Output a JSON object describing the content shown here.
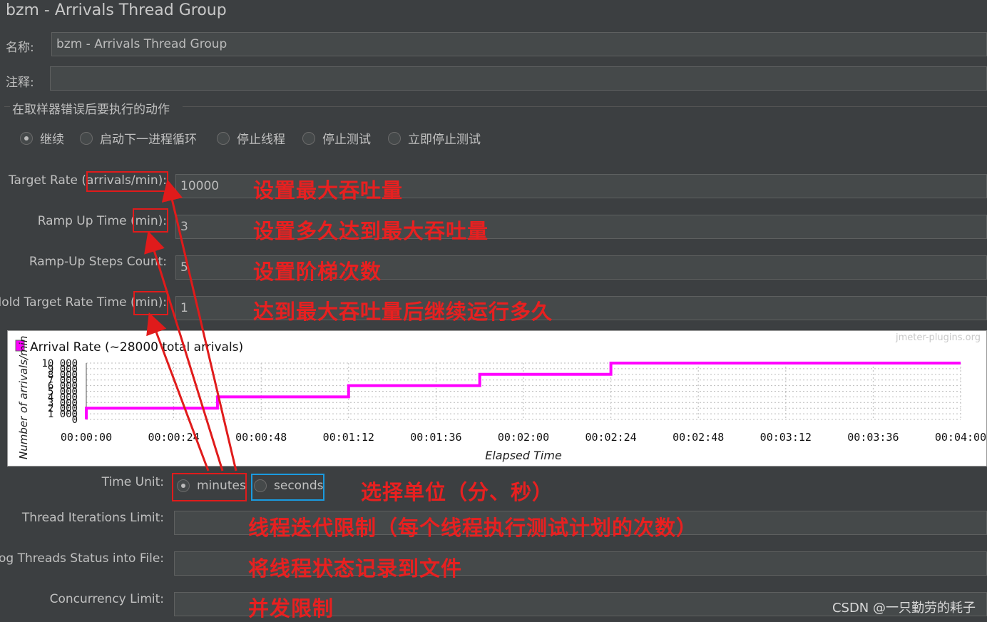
{
  "window": {
    "title": "bzm - Arrivals Thread Group"
  },
  "form": {
    "name_label": "名称:",
    "name_value": "bzm - Arrivals Thread Group",
    "comment_label": "注释:",
    "comment_value": "",
    "error_group_title": "在取样器错误后要执行的动作",
    "error_actions": [
      {
        "label": "继续",
        "selected": true
      },
      {
        "label": "启动下一进程循环",
        "selected": false
      },
      {
        "label": "停止线程",
        "selected": false
      },
      {
        "label": "停止测试",
        "selected": false
      },
      {
        "label": "立即停止测试",
        "selected": false
      }
    ],
    "target_rate_label": "Target Rate (arrivals/min):",
    "target_rate_value": "10000",
    "ramp_up_label": "Ramp Up Time (min):",
    "ramp_up_value": "3",
    "steps_label": "Ramp-Up Steps Count:",
    "steps_value": "5",
    "hold_label": "Hold Target Rate Time (min):",
    "hold_value": "1",
    "time_unit_label": "Time Unit:",
    "time_unit_options": [
      {
        "label": "minutes",
        "selected": true
      },
      {
        "label": "seconds",
        "selected": false
      }
    ],
    "iterations_label": "Thread Iterations Limit:",
    "iterations_value": "",
    "log_label": "Log Threads Status into File:",
    "log_value": "",
    "concurrency_label": "Concurrency Limit:",
    "concurrency_value": ""
  },
  "annotations": {
    "target_rate": "设置最大吞吐量",
    "ramp_up": "设置多久达到最大吞吐量",
    "steps": "设置阶梯次数",
    "hold": "达到最大吞吐量后继续运行多久",
    "time_unit": "选择单位（分、秒）",
    "iterations": "线程迭代限制（每个线程执行测试计划的次数）",
    "log": "将线程状态记录到文件",
    "concurrency": "并发限制"
  },
  "watermark": "jmeter-plugins.org",
  "credit": "CSDN @一只勤劳的耗子",
  "chart_data": {
    "type": "line",
    "legend": "Arrival Rate (~28000 total arrivals)",
    "series_color": "#ff00ff",
    "xlabel": "Elapsed Time",
    "ylabel": "Number of arrivals/min",
    "x_ticks": [
      "00:00:00",
      "00:00:24",
      "00:00:48",
      "00:01:12",
      "00:01:36",
      "00:02:00",
      "00:02:24",
      "00:02:48",
      "00:03:12",
      "00:03:36",
      "00:04:00"
    ],
    "y_ticks": [
      "0",
      "1 000",
      "2 000",
      "3 000",
      "4 000",
      "5 000",
      "6 000",
      "7 000",
      "8 000",
      "9 000",
      "10 000"
    ],
    "xlim": [
      0,
      240
    ],
    "ylim": [
      0,
      10000
    ],
    "grid": true,
    "x": [
      0,
      0,
      36,
      36,
      72,
      72,
      108,
      108,
      144,
      144,
      240
    ],
    "y": [
      0,
      2000,
      2000,
      4000,
      4000,
      6000,
      6000,
      8000,
      8000,
      10000,
      10000
    ]
  }
}
